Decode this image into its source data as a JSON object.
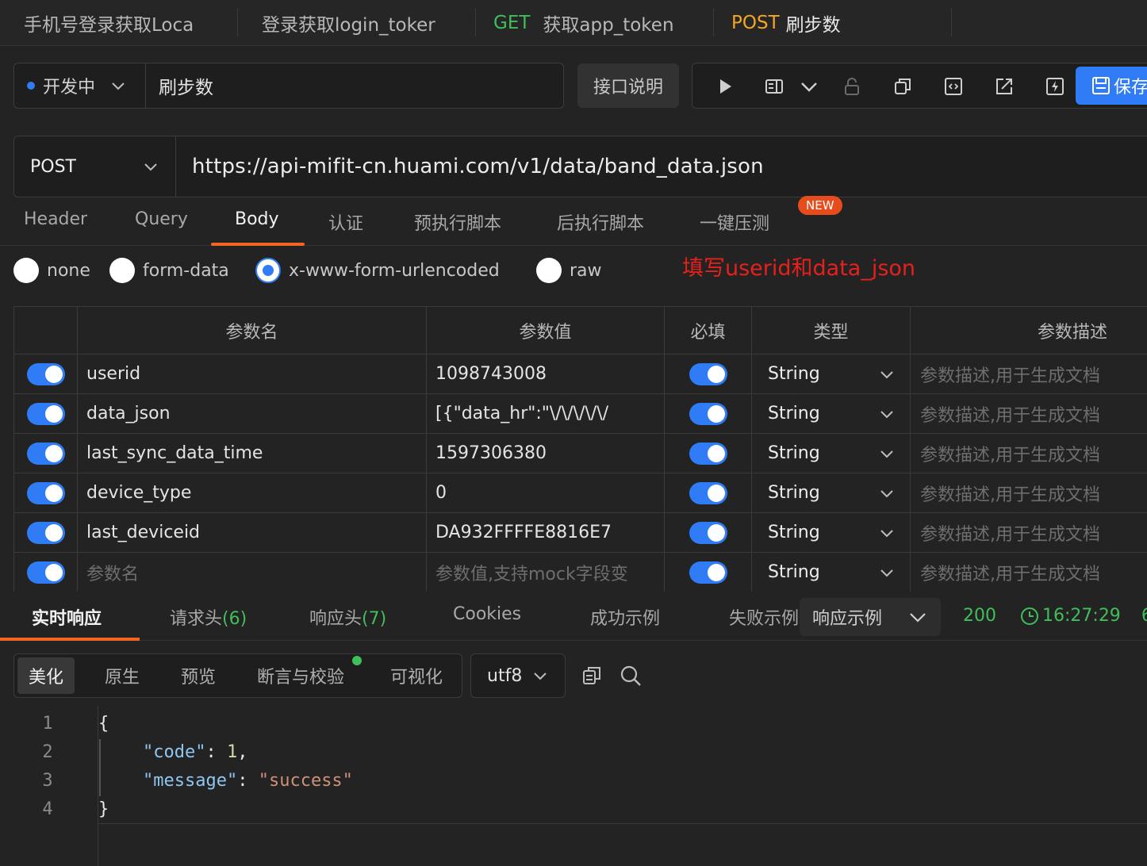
{
  "tabs": [
    {
      "method": "",
      "label": "手机号登录获取Loca"
    },
    {
      "method": "",
      "label": "登录获取login_toker"
    },
    {
      "method": "GET",
      "label": "获取app_token"
    },
    {
      "method": "POST",
      "label": "刷步数"
    }
  ],
  "env": {
    "label": "开发中",
    "name": "刷步数"
  },
  "doc_button": "接口说明",
  "save_button": "保存",
  "request": {
    "method": "POST",
    "url": "https://api-mifit-cn.huami.com/v1/data/band_data.json"
  },
  "request_tabs": [
    "Header",
    "Query",
    "Body",
    "认证",
    "预执行脚本",
    "后执行脚本",
    "一键压测"
  ],
  "new_badge": "NEW",
  "body_types": [
    "none",
    "form-data",
    "x-www-form-urlencoded",
    "raw"
  ],
  "selected_body_type": "x-www-form-urlencoded",
  "annotation": "填写userid和data_json",
  "params_table": {
    "headers": [
      "参数名",
      "参数值",
      "必填",
      "类型",
      "参数描述"
    ],
    "rows": [
      {
        "name": "userid",
        "value": "1098743008",
        "type": "String",
        "desc": "参数描述,用于生成文档"
      },
      {
        "name": "data_json",
        "value": "[{\"data_hr\":\"\\/\\/\\/\\/\\/",
        "type": "String",
        "desc": "参数描述,用于生成文档"
      },
      {
        "name": "last_sync_data_time",
        "value": "1597306380",
        "type": "String",
        "desc": "参数描述,用于生成文档"
      },
      {
        "name": "device_type",
        "value": "0",
        "type": "String",
        "desc": "参数描述,用于生成文档"
      },
      {
        "name": "last_deviceid",
        "value": "DA932FFFFE8816E7",
        "type": "String",
        "desc": "参数描述,用于生成文档"
      },
      {
        "name": "参数名",
        "value": "参数值,支持mock字段变",
        "type": "String",
        "desc": "参数描述,用于生成文档"
      }
    ]
  },
  "response_tabs": [
    {
      "label": "实时响应",
      "count": ""
    },
    {
      "label": "请求头",
      "count": "(6)"
    },
    {
      "label": "响应头",
      "count": "(7)"
    },
    {
      "label": "Cookies",
      "count": ""
    },
    {
      "label": "成功示例",
      "count": ""
    },
    {
      "label": "失败示例",
      "count": ""
    }
  ],
  "example_select": "响应示例",
  "status_code": "200",
  "response_time": "16:27:29",
  "time_suffix": "6",
  "view_modes": [
    "美化",
    "原生",
    "预览",
    "断言与校验",
    "可视化"
  ],
  "encoding": "utf8",
  "code_lines": [
    "1",
    "2",
    "3",
    "4"
  ],
  "code": {
    "open": "{",
    "key1": "\"code\"",
    "val1": "1",
    "key2": "\"message\"",
    "val2": "\"success\"",
    "close": "}"
  },
  "colors": {
    "accent": "#2f7cf6",
    "active_tab": "#f26522",
    "get": "#3fbf59",
    "post": "#f5a623",
    "annotation": "#e8201c"
  }
}
